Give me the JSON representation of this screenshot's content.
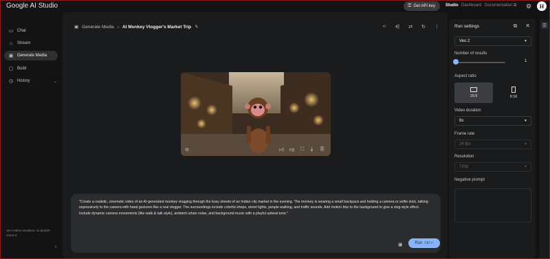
{
  "header": {
    "brand": "Google AI Studio",
    "api_key_button": "Get API key",
    "links": [
      "Studio",
      "Dashboard",
      "Documentation"
    ],
    "avatar_initial": "H"
  },
  "sidebar": {
    "items": [
      {
        "label": "Chat",
        "icon": "chat-icon"
      },
      {
        "label": "Stream",
        "icon": "stream-icon"
      },
      {
        "label": "Generate Media",
        "icon": "image-icon",
        "active": true
      },
      {
        "label": "Build",
        "icon": "build-icon"
      },
      {
        "label": "History",
        "icon": "history-icon"
      }
    ],
    "disclaimer": "Veo makes mistakes, so double-check it."
  },
  "main": {
    "breadcrumb_root": "Generate Media",
    "breadcrumb_title": "AI Monkey Vlogger's Market Trip",
    "prompt_text": "\"Create a realistic, cinematic video of an AI-generated monkey vlogging through the busy streets of an Indian city market in the evening. The monkey is wearing a small backpack and holding a camera or selfie stick, talking expressively to the camera with hand gestures like a real vlogger. The surroundings include colorful shops, street lights, people walking, and traffic sounds. Add motion blur to the background to give a vlog-style effect. Include dynamic camera movements (like walk & talk style), ambient urban noise, and background music with a playful upbeat tone.\"",
    "run_label": "Run",
    "run_shortcut": "Ctrl ↵"
  },
  "run_settings": {
    "title": "Run settings",
    "model": "Veo 2",
    "number_of_results_label": "Number of results",
    "number_of_results": "1",
    "number_of_results_fraction": 0.0,
    "aspect_ratio_label": "Aspect ratio",
    "aspect_options": [
      "16:9",
      "9:16"
    ],
    "video_duration_label": "Video duration",
    "video_duration": "8s",
    "frame_rate_label": "Frame rate",
    "frame_rate": "24 fps",
    "resolution_label": "Resolution",
    "resolution": "720p",
    "negative_prompt_label": "Negative prompt"
  },
  "colors": {
    "accent": "#8ab4f8",
    "background": "#131314",
    "panel": "#1a1b1c",
    "border": "#8b1a1a"
  }
}
